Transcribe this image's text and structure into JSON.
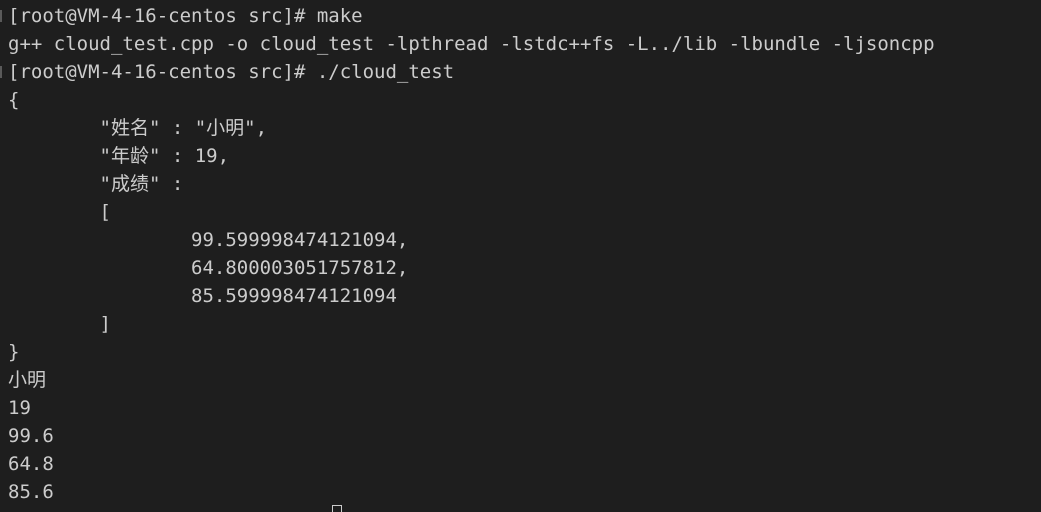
{
  "terminal": {
    "lines": [
      "[root@VM-4-16-centos src]# make",
      "g++ cloud_test.cpp -o cloud_test -lpthread -lstdc++fs -L../lib -lbundle -ljsoncpp",
      "[root@VM-4-16-centos src]# ./cloud_test",
      "{",
      "        \"姓名\" : \"小明\",",
      "        \"年龄\" : 19,",
      "        \"成绩\" :",
      "        [",
      "                99.599998474121094,",
      "                64.800003051757812,",
      "                85.599998474121094",
      "        ]",
      "}",
      "小明",
      "19",
      "99.6",
      "64.8",
      "85.6"
    ]
  }
}
